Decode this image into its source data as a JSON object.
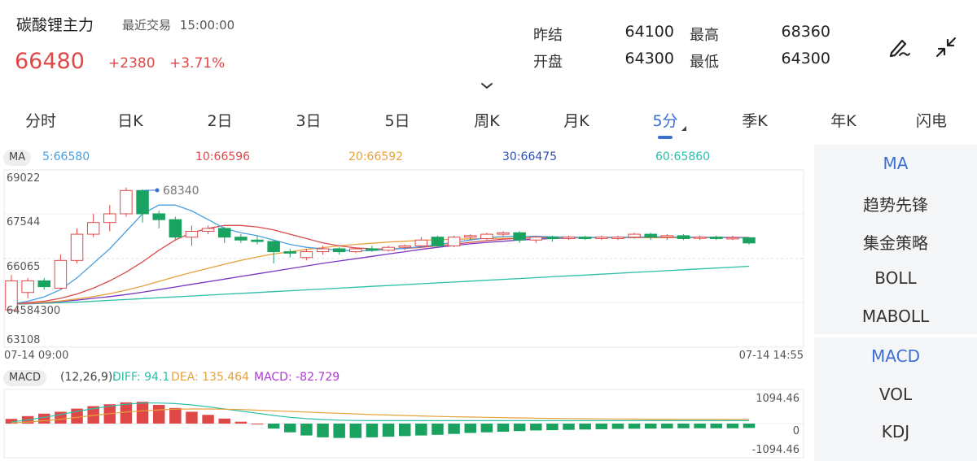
{
  "header": {
    "title": "碳酸锂主力",
    "status": "最近交易",
    "time": "15:00:00",
    "price": "66480",
    "change": "+2380",
    "change_pct": "+3.71%"
  },
  "stats": {
    "prev_settle_label": "昨结",
    "prev_settle": "64100",
    "open_label": "开盘",
    "open": "64300",
    "high_label": "最高",
    "high": "68360",
    "low_label": "最低",
    "low": "64300"
  },
  "tabs": [
    "分时",
    "日K",
    "2日",
    "3日",
    "5日",
    "周K",
    "月K",
    "5分",
    "季K",
    "年K",
    "闪电"
  ],
  "active_tab": "5分",
  "ma": {
    "badge": "MA",
    "items": [
      {
        "label": "5:66580",
        "color": "#4a9fe0"
      },
      {
        "label": "10:66596",
        "color": "#d94b4b"
      },
      {
        "label": "20:66592",
        "color": "#e6a23c"
      },
      {
        "label": "30:66475",
        "color": "#2a4fb8"
      },
      {
        "label": "60:65860",
        "color": "#2bbfa8"
      }
    ]
  },
  "price_axis": [
    "69022",
    "67544",
    "66065",
    "64584300",
    "63108"
  ],
  "max_marker": "68340",
  "time_start": "07-14 09:00",
  "time_end": "07-14 14:55",
  "macd": {
    "badge": "MACD",
    "params": "(12,26,9):",
    "diff": "DIFF: 94.1",
    "dea": "DEA: 135.464",
    "macd": "MACD: -82.729",
    "axis_top": "1094.46",
    "axis_mid": "0",
    "axis_bottom": "-1094.46"
  },
  "sidebar": {
    "items": [
      "MA",
      "趋势先锋",
      "集金策略",
      "BOLL",
      "MABOLL"
    ],
    "items2": [
      "MACD",
      "VOL",
      "KDJ"
    ],
    "active": [
      "MA",
      "MACD"
    ]
  },
  "colors": {
    "up": "#e04848",
    "down": "#1aa260",
    "accent": "#3b6fd4",
    "ma5": "#4a9fe0",
    "ma10": "#d94b4b",
    "ma20": "#e6a23c",
    "ma30": "#7a35c2",
    "ma60": "#2bbfa8"
  },
  "chart_data": {
    "type": "candlestick",
    "candles": [
      {
        "o": 64300,
        "c": 65300,
        "h": 65500,
        "l": 64300
      },
      {
        "o": 64900,
        "c": 65300,
        "h": 65400,
        "l": 64700
      },
      {
        "o": 65300,
        "c": 65100,
        "h": 65400,
        "l": 65000
      },
      {
        "o": 65050,
        "c": 66000,
        "h": 66200,
        "l": 65000
      },
      {
        "o": 66000,
        "c": 66900,
        "h": 67100,
        "l": 65900
      },
      {
        "o": 66900,
        "c": 67300,
        "h": 67600,
        "l": 66800
      },
      {
        "o": 67300,
        "c": 67600,
        "h": 67900,
        "l": 67000
      },
      {
        "o": 67600,
        "c": 68400,
        "h": 68500,
        "l": 67500
      },
      {
        "o": 68400,
        "c": 67600,
        "h": 68440,
        "l": 67300
      },
      {
        "o": 67600,
        "c": 67400,
        "h": 67700,
        "l": 67100
      },
      {
        "o": 67400,
        "c": 66800,
        "h": 67500,
        "l": 66700
      },
      {
        "o": 66800,
        "c": 67000,
        "h": 67200,
        "l": 66500
      },
      {
        "o": 67000,
        "c": 67100,
        "h": 67200,
        "l": 66900
      },
      {
        "o": 67100,
        "c": 66800,
        "h": 67150,
        "l": 66600
      },
      {
        "o": 66800,
        "c": 66700,
        "h": 66900,
        "l": 66600
      },
      {
        "o": 66700,
        "c": 66650,
        "h": 66850,
        "l": 66550
      },
      {
        "o": 66650,
        "c": 66300,
        "h": 66700,
        "l": 65900
      },
      {
        "o": 66300,
        "c": 66250,
        "h": 66400,
        "l": 66100
      },
      {
        "o": 66100,
        "c": 66300,
        "h": 66400,
        "l": 66000
      },
      {
        "o": 66300,
        "c": 66400,
        "h": 66500,
        "l": 66200
      },
      {
        "o": 66400,
        "c": 66300,
        "h": 66450,
        "l": 66200
      },
      {
        "o": 66300,
        "c": 66400,
        "h": 66450,
        "l": 66250
      },
      {
        "o": 66400,
        "c": 66350,
        "h": 66500,
        "l": 66300
      },
      {
        "o": 66350,
        "c": 66450,
        "h": 66500,
        "l": 66300
      },
      {
        "o": 66450,
        "c": 66500,
        "h": 66550,
        "l": 66350
      },
      {
        "o": 66500,
        "c": 66700,
        "h": 66800,
        "l": 66450
      },
      {
        "o": 66800,
        "c": 66500,
        "h": 66850,
        "l": 66450
      },
      {
        "o": 66500,
        "c": 66800,
        "h": 66850,
        "l": 66450
      },
      {
        "o": 66800,
        "c": 66850,
        "h": 66900,
        "l": 66700
      },
      {
        "o": 66750,
        "c": 66900,
        "h": 66950,
        "l": 66700
      },
      {
        "o": 66900,
        "c": 66950,
        "h": 67000,
        "l": 66800
      },
      {
        "o": 66950,
        "c": 66700,
        "h": 67000,
        "l": 66600
      },
      {
        "o": 66700,
        "c": 66800,
        "h": 66850,
        "l": 66600
      },
      {
        "o": 66800,
        "c": 66750,
        "h": 66850,
        "l": 66650
      },
      {
        "o": 66750,
        "c": 66800,
        "h": 66850,
        "l": 66700
      },
      {
        "o": 66800,
        "c": 66750,
        "h": 66850,
        "l": 66700
      },
      {
        "o": 66750,
        "c": 66800,
        "h": 66850,
        "l": 66700
      },
      {
        "o": 66750,
        "c": 66800,
        "h": 66850,
        "l": 66700
      },
      {
        "o": 66800,
        "c": 66900,
        "h": 66950,
        "l": 66750
      },
      {
        "o": 66900,
        "c": 66800,
        "h": 66950,
        "l": 66700
      },
      {
        "o": 66800,
        "c": 66850,
        "h": 66900,
        "l": 66700
      },
      {
        "o": 66850,
        "c": 66750,
        "h": 66900,
        "l": 66700
      },
      {
        "o": 66800,
        "c": 66800,
        "h": 66850,
        "l": 66700
      },
      {
        "o": 66800,
        "c": 66750,
        "h": 66850,
        "l": 66700
      },
      {
        "o": 66750,
        "c": 66780,
        "h": 66850,
        "l": 66700
      },
      {
        "o": 66780,
        "c": 66600,
        "h": 66800,
        "l": 66550
      }
    ],
    "ma5": [
      64500,
      64600,
      64750,
      65000,
      65400,
      65900,
      66400,
      67000,
      67600,
      67900,
      67900,
      67700,
      67400,
      67100,
      66950,
      66850,
      66700,
      66550,
      66450,
      66400,
      66350,
      66330,
      66340,
      66380,
      66420,
      66470,
      66550,
      66620,
      66700,
      66780,
      66820,
      66830,
      66830,
      66810,
      66800,
      66790,
      66790,
      66790,
      66800,
      66810,
      66810,
      66800,
      66790,
      66790,
      66780,
      66770
    ],
    "ma10": [
      64500,
      64550,
      64600,
      64700,
      64850,
      65050,
      65300,
      65600,
      65950,
      66350,
      66700,
      66950,
      67100,
      67200,
      67200,
      67150,
      67050,
      66900,
      66750,
      66600,
      66500,
      66430,
      66400,
      66390,
      66410,
      66450,
      66500,
      66560,
      66620,
      66680,
      66730,
      66760,
      66780,
      66790,
      66790,
      66790,
      66790,
      66790,
      66790,
      66800,
      66800,
      66800,
      66790,
      66790,
      66790,
      66780
    ],
    "ma20": [
      64500,
      64530,
      64560,
      64610,
      64680,
      64760,
      64860,
      64980,
      65120,
      65280,
      65440,
      65590,
      65730,
      65870,
      66000,
      66120,
      66220,
      66300,
      66380,
      66440,
      66500,
      66550,
      66590,
      66630,
      66660,
      66690,
      66710,
      66730,
      66740,
      66750,
      66760,
      66770,
      66780,
      66780,
      66780,
      66780,
      66780,
      66780,
      66780,
      66780,
      66780,
      66780,
      66780,
      66780,
      66780,
      66780
    ],
    "ma30": [
      64500,
      64520,
      64550,
      64590,
      64640,
      64700,
      64760,
      64830,
      64910,
      65000,
      65090,
      65180,
      65270,
      65360,
      65450,
      65540,
      65630,
      65720,
      65810,
      65900,
      65980,
      66060,
      66140,
      66220,
      66300,
      66380,
      66450,
      66510,
      66570,
      66620,
      66660,
      66700,
      66730,
      66750,
      66770,
      66780,
      66790,
      66790,
      66790,
      66790,
      66790,
      66790,
      66790,
      66790,
      66790,
      66790
    ],
    "ma60": [
      64500,
      64510,
      64530,
      64550,
      64570,
      64600,
      64630,
      64660,
      64690,
      64720,
      64750,
      64780,
      64810,
      64840,
      64870,
      64900,
      64930,
      64960,
      64990,
      65020,
      65050,
      65080,
      65110,
      65140,
      65170,
      65200,
      65230,
      65260,
      65290,
      65320,
      65350,
      65380,
      65410,
      65440,
      65470,
      65500,
      65530,
      65560,
      65590,
      65620,
      65650,
      65680,
      65710,
      65740,
      65770,
      65800
    ],
    "ylim": [
      63108,
      69022
    ],
    "macd_hist": [
      150,
      240,
      320,
      380,
      480,
      560,
      620,
      680,
      700,
      600,
      500,
      380,
      280,
      160,
      60,
      0,
      -160,
      -280,
      -380,
      -440,
      -460,
      -460,
      -440,
      -420,
      -400,
      -380,
      -360,
      -330,
      -300,
      -280,
      -260,
      -240,
      -220,
      -210,
      -200,
      -190,
      -180,
      -170,
      -165,
      -160,
      -155,
      -150,
      -150,
      -150,
      -150,
      -140
    ],
    "macd_diff": [
      50,
      120,
      200,
      290,
      390,
      480,
      560,
      620,
      660,
      660,
      640,
      600,
      540,
      470,
      400,
      330,
      260,
      200,
      160,
      130,
      110,
      100,
      95,
      95,
      95,
      95,
      95,
      95,
      95,
      95,
      95,
      95,
      95,
      95,
      95,
      95,
      95,
      95,
      95,
      95,
      95,
      95,
      95,
      95,
      95,
      94
    ],
    "macd_dea": [
      20,
      50,
      90,
      140,
      200,
      260,
      320,
      370,
      410,
      440,
      460,
      470,
      470,
      460,
      450,
      430,
      410,
      390,
      370,
      350,
      330,
      310,
      290,
      275,
      260,
      245,
      230,
      220,
      210,
      200,
      190,
      182,
      175,
      168,
      162,
      157,
      152,
      148,
      145,
      142,
      140,
      139,
      138,
      137,
      136,
      135
    ]
  }
}
